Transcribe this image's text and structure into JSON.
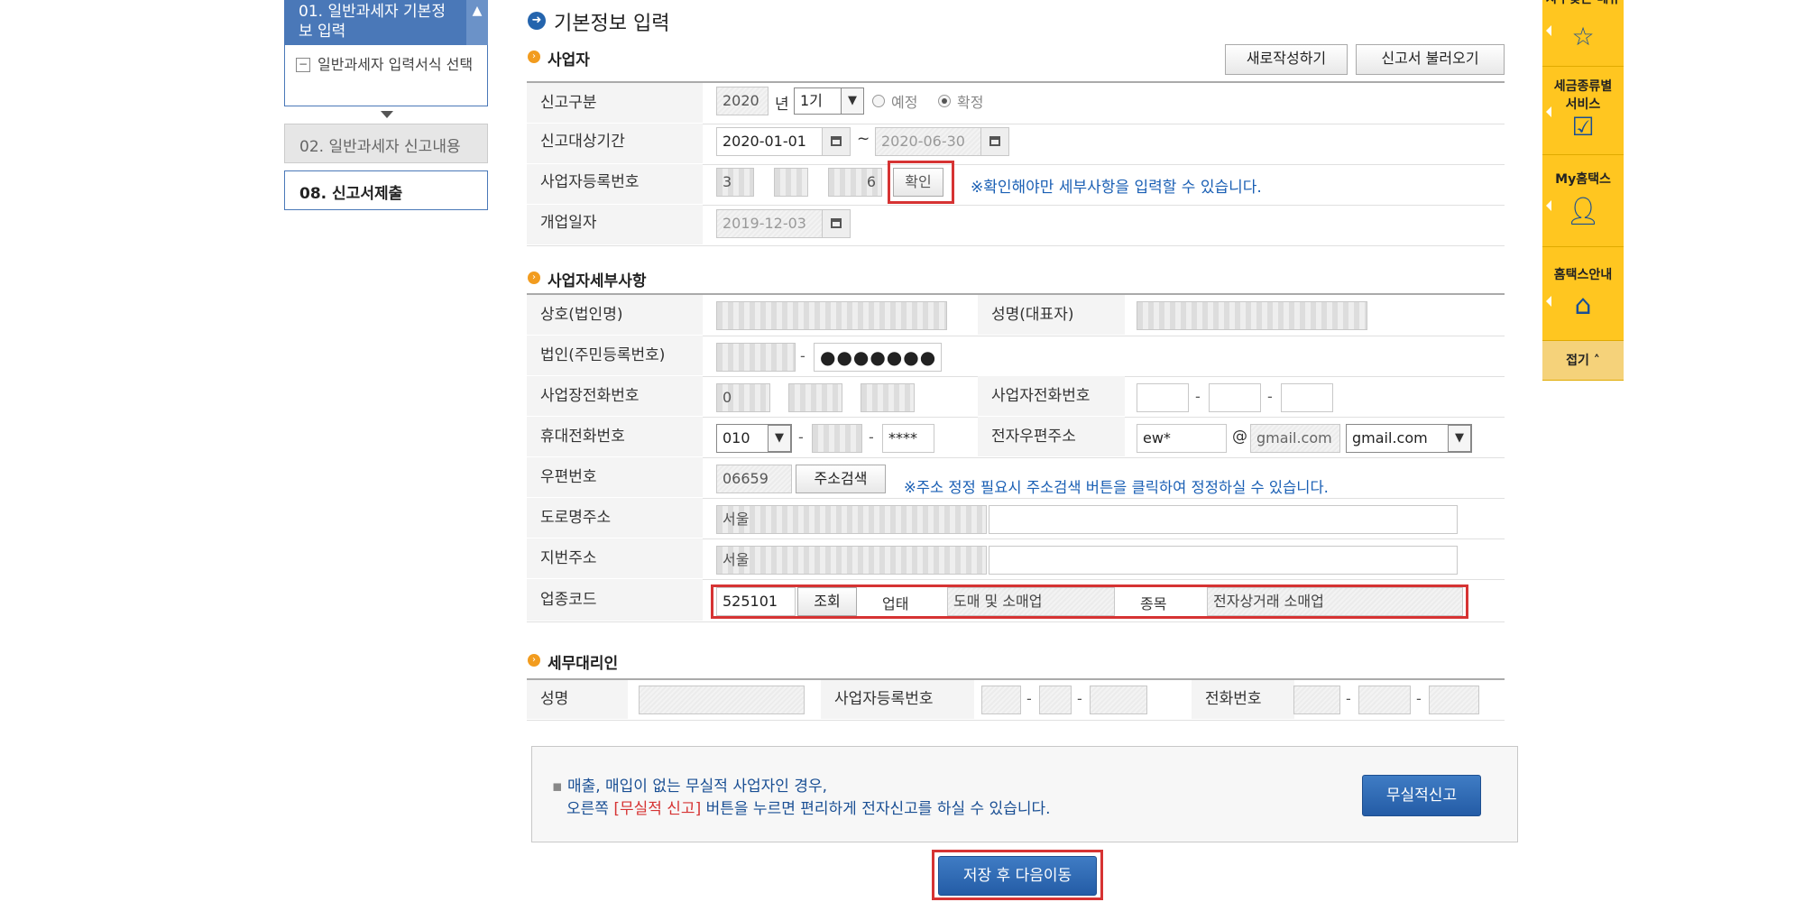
{
  "sidebar": {
    "active_step": "01. 일반과세자 기본정보 입력",
    "sub_item": "일반과세자 입력서식 선택",
    "step2": "02. 일반과세자 신고내용",
    "step8": "08. 신고서제출"
  },
  "page_title": "기본정보 입력",
  "section_business": {
    "title": "사업자",
    "new_button": "새로작성하기",
    "load_button": "신고서 불러오기",
    "report_type_label": "신고구분",
    "year": "2020",
    "year_unit": "년",
    "period": "1기",
    "radio_preliminary": "예정",
    "radio_final": "확정",
    "period_label": "신고대상기간",
    "period_from": "2020-01-01",
    "period_tilde": "~",
    "period_to": "2020-06-30",
    "reg_no_label": "사업자등록번호",
    "reg_no_part1": "3",
    "reg_no_part3": "6",
    "confirm_button": "확인",
    "confirm_note": "※확인해야만 세부사항을 입력할 수 있습니다.",
    "open_date_label": "개업일자",
    "open_date": "2019-12-03"
  },
  "section_detail": {
    "title": "사업자세부사항",
    "company_name_label": "상호(법인명)",
    "rep_name_label": "성명(대표자)",
    "corp_no_label": "법인(주민등록번호)",
    "corp_no_masked": "●●●●●●●",
    "biz_phone_label": "사업장전화번호",
    "biz_phone_part1": "0",
    "owner_phone_label": "사업자전화번호",
    "mobile_label": "휴대전화번호",
    "mobile_prefix": "010",
    "mobile_last": "****",
    "email_label": "전자우편주소",
    "email_id": "ew*",
    "email_at": "@",
    "email_domain": "gmail.com",
    "email_select": "gmail.com",
    "zip_label": "우편번호",
    "zip": "06659",
    "addr_search_button": "주소검색",
    "addr_note": "※주소 정정 필요시 주소검색 버튼을 클릭하여 정정하실 수 있습니다.",
    "road_addr_label": "도로명주소",
    "road_addr_prefix": "서울",
    "lot_addr_label": "지번주소",
    "lot_addr_prefix": "서울",
    "industry_code_label": "업종코드",
    "industry_code": "525101",
    "lookup_button": "조회",
    "business_type_label": "업태",
    "business_type": "도매 및 소매업",
    "item_label": "종목",
    "item": "전자상거래 소매업"
  },
  "section_agent": {
    "title": "세무대리인",
    "name_label": "성명",
    "reg_no_label": "사업자등록번호",
    "phone_label": "전화번호"
  },
  "notice": {
    "line1": "매출, 매입이 없는 무실적 사업자인 경우,",
    "line2_pre": "오른쪽 ",
    "line2_highlight": "[무실적 신고]",
    "line2_post": " 버튼을 누르면 편리하게 전자신고를 하실 수 있습니다.",
    "no_record_button": "무실적신고"
  },
  "save_next_button": "저장 후 다음이동",
  "quick_menu": {
    "item1": "자주찾는 메뉴",
    "item2": "세금종류별 서비스",
    "item3": "My홈택스",
    "item4": "홈택스안내",
    "collapse": "접기"
  },
  "colors": {
    "accent": "#2464ad",
    "highlight_red": "#d63333",
    "quick_menu": "#ffc620",
    "section_icon": "#f29c1f"
  }
}
